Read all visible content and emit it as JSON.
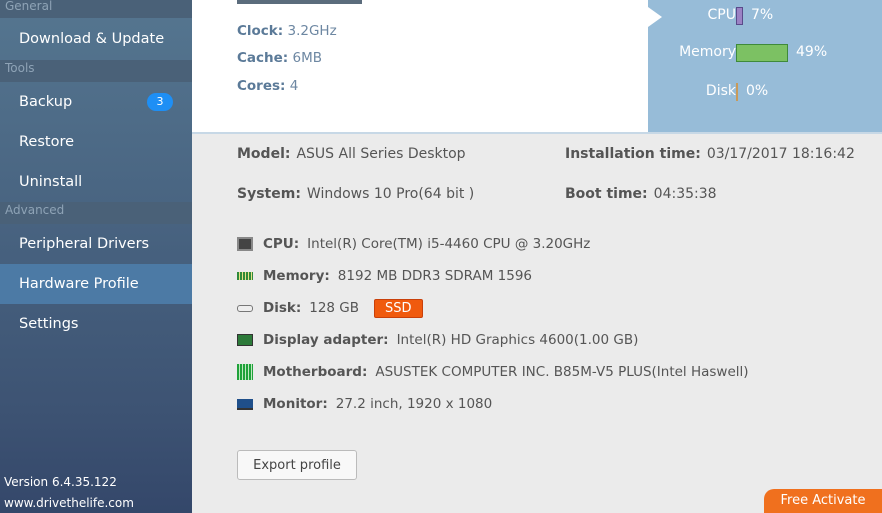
{
  "sidebar": {
    "sections": [
      "General",
      "Tools",
      "Advanced"
    ],
    "items": {
      "download": "Download & Update",
      "backup": "Backup",
      "backup_badge": "3",
      "restore": "Restore",
      "uninstall": "Uninstall",
      "peripheral": "Peripheral Drivers",
      "hardware": "Hardware Profile",
      "settings": "Settings"
    },
    "version": "Version 6.4.35.122",
    "site": "www.drivethelife.com"
  },
  "cpu_panel": {
    "clock_label": "Clock:",
    "clock": "3.2GHz",
    "cache_label": "Cache:",
    "cache": "6MB",
    "cores_label": "Cores:",
    "cores": "4"
  },
  "usage": {
    "cpu_label": "CPU",
    "cpu": "7%",
    "cpu_pct": 7,
    "mem_label": "Memory",
    "mem": "49%",
    "mem_pct": 49,
    "disk_label": "Disk",
    "disk": "0%",
    "disk_pct": 0,
    "colors": {
      "cpu": "#9b82c4",
      "mem": "#7cc163",
      "disk": "#c89a5a"
    }
  },
  "info": {
    "model_label": "Model:",
    "model": "ASUS All Series Desktop",
    "system_label": "System:",
    "system": "Windows 10 Pro(64 bit )",
    "install_label": "Installation time:",
    "install": "03/17/2017  18:16:42",
    "boot_label": "Boot time:",
    "boot": "04:35:38"
  },
  "hardware": {
    "cpu_label": "CPU:",
    "cpu": "Intel(R) Core(TM) i5-4460  CPU @ 3.20GHz",
    "mem_label": "Memory:",
    "mem": "8192 MB DDR3 SDRAM 1596",
    "disk_label": "Disk:",
    "disk": "128 GB",
    "disk_badge": "SSD",
    "display_label": "Display adapter:",
    "display": "Intel(R) HD Graphics 4600(1.00 GB)",
    "mb_label": "Motherboard:",
    "mb": "ASUSTEK COMPUTER INC. B85M-V5 PLUS(Intel Haswell)",
    "monitor_label": "Monitor:",
    "monitor": "27.2 inch, 1920 x 1080"
  },
  "buttons": {
    "export": "Export profile",
    "free": "Free Activate"
  }
}
